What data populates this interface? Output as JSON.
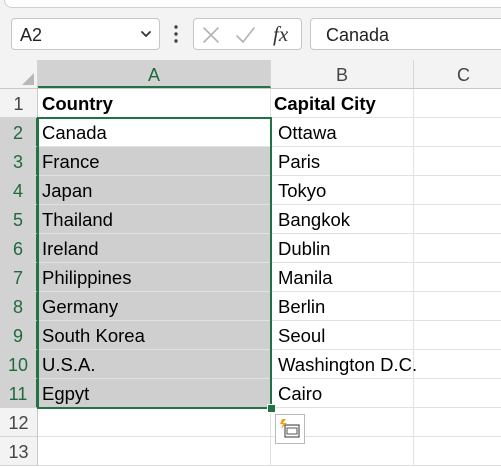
{
  "formula_bar": {
    "name_box": "A2",
    "formula_value": "Canada",
    "fx_label": "fx"
  },
  "columns": [
    {
      "label": "A",
      "selected": true
    },
    {
      "label": "B",
      "selected": false
    },
    {
      "label": "C",
      "selected": false
    }
  ],
  "rows": [
    {
      "num": "1",
      "a": "Country",
      "b": "Capital City",
      "header": true
    },
    {
      "num": "2",
      "a": "Canada",
      "b": "Ottawa"
    },
    {
      "num": "3",
      "a": "France",
      "b": "Paris"
    },
    {
      "num": "4",
      "a": "Japan",
      "b": "Tokyo"
    },
    {
      "num": "5",
      "a": "Thailand",
      "b": "Bangkok"
    },
    {
      "num": "6",
      "a": "Ireland",
      "b": "Dublin"
    },
    {
      "num": "7",
      "a": "Philippines",
      "b": "Manila"
    },
    {
      "num": "8",
      "a": "Germany",
      "b": "Berlin"
    },
    {
      "num": "9",
      "a": "South Korea",
      "b": "Seoul"
    },
    {
      "num": "10",
      "a": "U.S.A.",
      "b": "Washington D.C."
    },
    {
      "num": "11",
      "a": "Egpyt",
      "b": "Cairo"
    },
    {
      "num": "12",
      "a": "",
      "b": ""
    },
    {
      "num": "13",
      "a": "",
      "b": ""
    }
  ],
  "selection": {
    "active_cell": "A2",
    "range": "A2:A11"
  },
  "colors": {
    "accent": "#217346",
    "selection_fill": "#cfcfcf",
    "chrome": "#f3f3f3"
  }
}
